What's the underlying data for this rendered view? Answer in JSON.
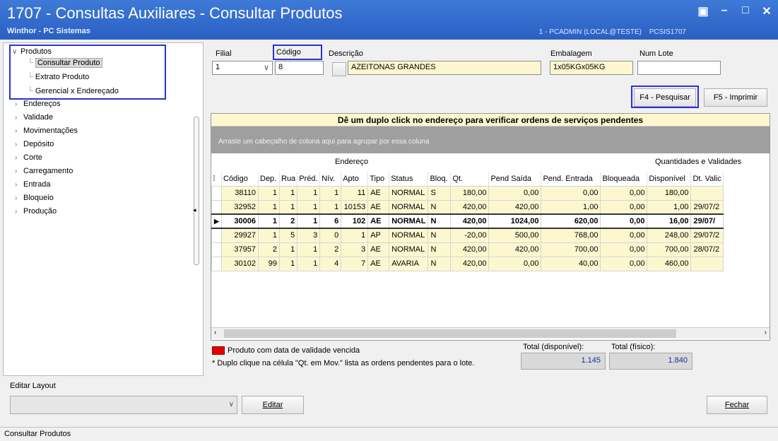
{
  "window": {
    "title": "1707 - Consultas Auxiliares - Consultar Produtos",
    "subtitle": "Winthor - PC Sistemas",
    "session": "1 - PCADMIN (LOCAL@TESTE)",
    "module": "PCSIS1707"
  },
  "tree": {
    "root": "Produtos",
    "children": [
      "Consultar Produto",
      "Extrato Produto",
      "Gerencial x Endereçado"
    ],
    "items": [
      "Endereços",
      "Validade",
      "Movimentações",
      "Depósito",
      "Corte",
      "Carregamento",
      "Entrada",
      "Bloqueio",
      "Produção"
    ]
  },
  "filters": {
    "filial_label": "Filial",
    "filial_value": "1",
    "codigo_label": "Código",
    "codigo_value": "8",
    "descricao_label": "Descrição",
    "descricao_btn": "...",
    "descricao_value": "AZEITONAS GRANDES",
    "embalagem_label": "Embalagem",
    "embalagem_value": "1x05KGx05KG",
    "numlote_label": "Num Lote",
    "numlote_value": ""
  },
  "buttons": {
    "pesquisar": "F4 - Pesquisar",
    "imprimir": "F5 - Imprimir",
    "editar": "Editar",
    "fechar": "Fechar"
  },
  "grid": {
    "banner": "Dê um duplo click no endereço para verificar ordens de serviços pendentes",
    "group_hint": "Arraste um cabeçalho de coluna aqui para agrupar por essa coluna",
    "group_endereco": "Endereço",
    "group_qtd": "Quantidades e Validades",
    "headers": [
      "Código",
      "Dep.",
      "Rua",
      "Préd.",
      "Nív.",
      "Apto",
      "Tipo",
      "Status",
      "Bloq.",
      "Qt.",
      "Pend Saída",
      "Pend. Entrada",
      "Bloqueada",
      "Disponível",
      "Dt. Valic"
    ],
    "rows": [
      [
        "38110",
        "1",
        "1",
        "1",
        "1",
        "11",
        "AE",
        "NORMAL",
        "S",
        "180,00",
        "0,00",
        "0,00",
        "0,00",
        "180,00",
        ""
      ],
      [
        "32952",
        "1",
        "1",
        "1",
        "1",
        "10153",
        "AE",
        "NORMAL",
        "N",
        "420,00",
        "420,00",
        "1,00",
        "0,00",
        "1,00",
        "29/07/2"
      ],
      [
        "30006",
        "1",
        "2",
        "1",
        "6",
        "102",
        "AE",
        "NORMAL",
        "N",
        "420,00",
        "1024,00",
        "620,00",
        "0,00",
        "16,00",
        "29/07/"
      ],
      [
        "29927",
        "1",
        "5",
        "3",
        "0",
        "1",
        "AP",
        "NORMAL",
        "N",
        "-20,00",
        "500,00",
        "768,00",
        "0,00",
        "248,00",
        "29/07/2"
      ],
      [
        "37957",
        "2",
        "1",
        "1",
        "2",
        "3",
        "AE",
        "NORMAL",
        "N",
        "420,00",
        "420,00",
        "700,00",
        "0,00",
        "700,00",
        "28/07/2"
      ],
      [
        "30102",
        "99",
        "1",
        "1",
        "4",
        "7",
        "AE",
        "AVARIA",
        "N",
        "420,00",
        "0,00",
        "40,00",
        "0,00",
        "460,00",
        ""
      ]
    ],
    "selected_row": 2
  },
  "legend": {
    "vencido": "Produto com data de validade vencida",
    "note": "* Duplo clique na célula \"Qt. em Mov.\" lista as ordens pendentes para o lote."
  },
  "totals": {
    "disponivel_label": "Total (disponível):",
    "disponivel_value": "1.145",
    "fisico_label": "Total (físico):",
    "fisico_value": "1.840"
  },
  "layout_panel": {
    "label": "Editar Layout",
    "combo_value": ""
  },
  "status": {
    "text": "Consultar Produtos"
  },
  "colors": {
    "titlebar": "#2a5fc2",
    "highlight_box": "#2a31d6",
    "row_bg": "#fdf7d0",
    "expired": "#e00000"
  }
}
